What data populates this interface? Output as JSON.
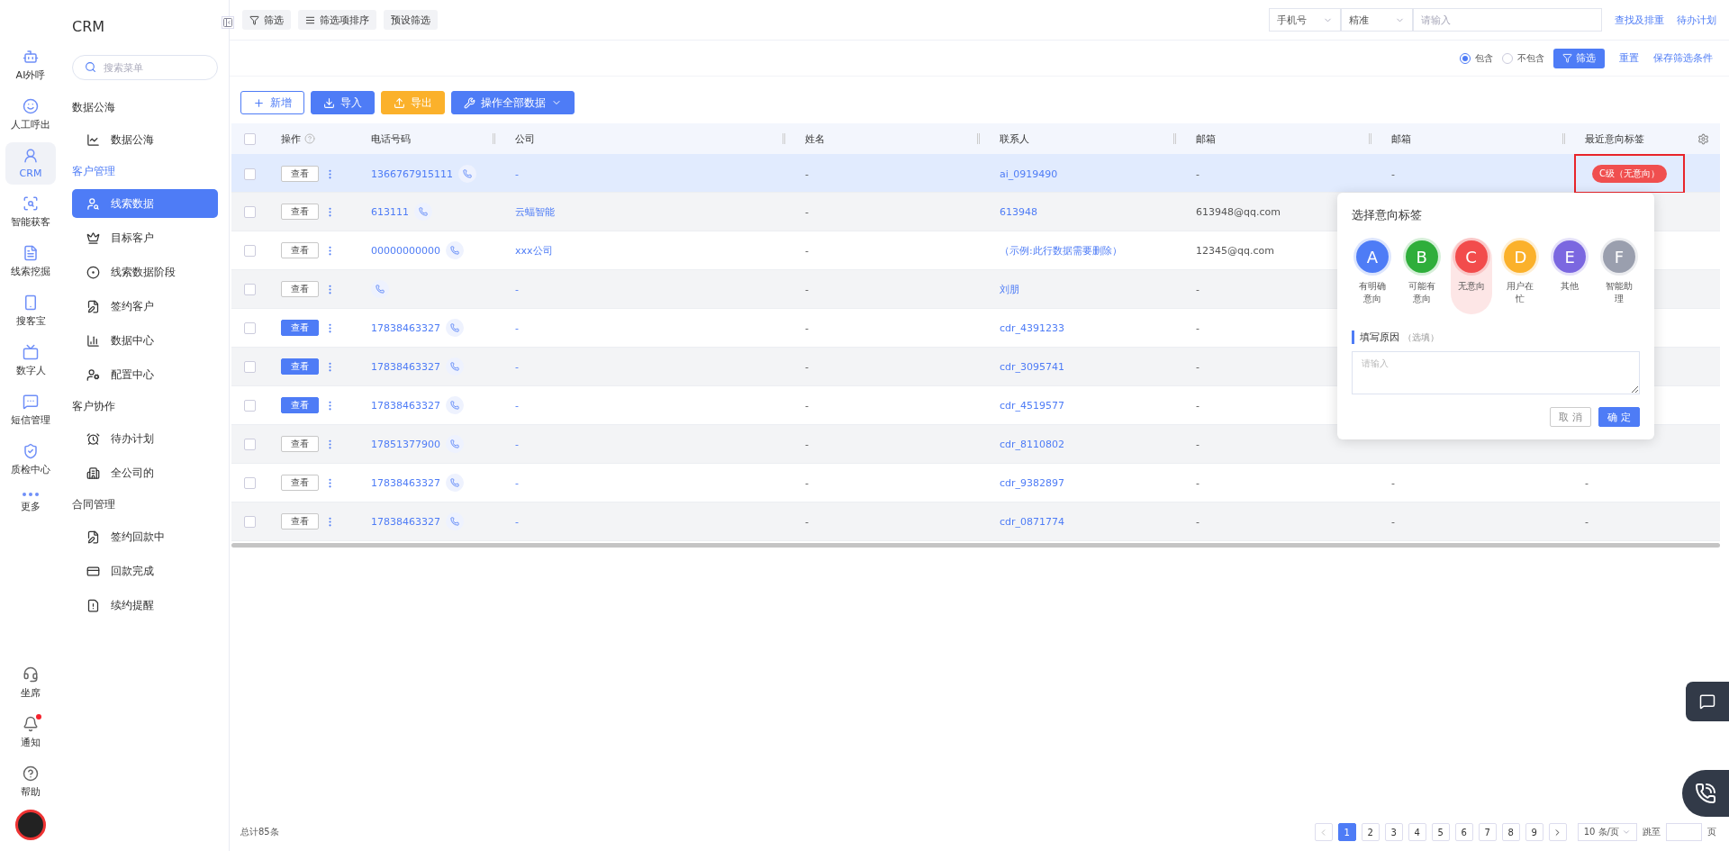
{
  "rail": {
    "items": [
      {
        "label": "AI外呼",
        "selected": false
      },
      {
        "label": "人工呼出",
        "selected": false
      },
      {
        "label": "CRM",
        "selected": true
      },
      {
        "label": "智能获客",
        "selected": false
      },
      {
        "label": "线索挖掘",
        "selected": false
      },
      {
        "label": "搜客宝",
        "selected": false
      },
      {
        "label": "数字人",
        "selected": false
      },
      {
        "label": "短信管理",
        "selected": false
      },
      {
        "label": "质检中心",
        "selected": false
      },
      {
        "label": "更多",
        "selected": false
      }
    ],
    "bottom": [
      {
        "label": "坐席",
        "has_dot": false
      },
      {
        "label": "通知",
        "has_dot": true
      },
      {
        "label": "帮助",
        "has_dot": false
      }
    ]
  },
  "sidebar": {
    "title": "CRM",
    "search": {
      "placeholder": "搜索菜单"
    },
    "groups": [
      {
        "label": "数据公海",
        "active": false,
        "items": [
          {
            "label": "数据公海",
            "selected": false
          }
        ]
      },
      {
        "label": "客户管理",
        "active": true,
        "items": [
          {
            "label": "线索数据",
            "selected": true
          },
          {
            "label": "目标客户",
            "selected": false
          },
          {
            "label": "线索数据阶段",
            "selected": false
          },
          {
            "label": "签约客户",
            "selected": false
          },
          {
            "label": "数据中心",
            "selected": false
          },
          {
            "label": "配置中心",
            "selected": false
          }
        ]
      },
      {
        "label": "客户协作",
        "active": false,
        "items": [
          {
            "label": "待办计划",
            "selected": false
          },
          {
            "label": "全公司的",
            "selected": false
          }
        ]
      },
      {
        "label": "合同管理",
        "active": false,
        "items": [
          {
            "label": "签约回款中",
            "selected": false
          },
          {
            "label": "回款完成",
            "selected": false
          },
          {
            "label": "续约提醒",
            "selected": false
          }
        ]
      }
    ]
  },
  "topbar": {
    "filter_buttons": [
      "筛选",
      "筛选项排序",
      "预设筛选"
    ],
    "field_select": "手机号",
    "match_select": "精准",
    "search": {
      "placeholder": "请输入"
    },
    "links": [
      "查找及排重",
      "待办计划"
    ]
  },
  "filter_row": {
    "options": [
      {
        "label": "包含",
        "selected": true
      },
      {
        "label": "不包含",
        "selected": false
      }
    ],
    "filter_button": "筛选",
    "links": [
      "重置",
      "保存筛选条件"
    ]
  },
  "toolbar": [
    {
      "label": "新增",
      "kind": "outline"
    },
    {
      "label": "导入",
      "kind": "primary"
    },
    {
      "label": "导出",
      "kind": "warning"
    },
    {
      "label": "操作全部数据",
      "kind": "dropdown"
    }
  ],
  "table": {
    "header_checked": false,
    "columns": [
      "操作",
      "电话号码",
      "公司",
      "姓名",
      "联系人",
      "邮箱",
      "邮箱",
      "最近意向标签"
    ],
    "rows": [
      {
        "checked": false,
        "selected": true,
        "view": "查看",
        "view_filled": false,
        "phone": "1366767915111",
        "company": "-",
        "name": "-",
        "contact": "ai_0919490",
        "email": "-",
        "email_2": "-",
        "tag": "C级（无意向）",
        "tag_highlighted": true
      },
      {
        "checked": false,
        "selected": false,
        "view": "查看",
        "view_filled": false,
        "phone": "613111",
        "company": "云蝠智能",
        "name": "-",
        "contact": "613948",
        "email": "613948@qq.com"
      },
      {
        "checked": false,
        "selected": false,
        "view": "查看",
        "view_filled": false,
        "phone": "00000000000",
        "company": "xxx公司",
        "name": "-",
        "contact": "（示例:此行数据需要删除）",
        "email": "12345@qq.com"
      },
      {
        "checked": false,
        "selected": false,
        "view": "查看",
        "view_filled": false,
        "company": "-",
        "name": "-",
        "contact": "刘朋",
        "email": "-"
      },
      {
        "checked": false,
        "selected": false,
        "view": "查看",
        "view_filled": true,
        "phone": "17838463327",
        "company": "-",
        "name": "-",
        "contact": "cdr_4391233",
        "email": "-"
      },
      {
        "checked": false,
        "selected": false,
        "view": "查看",
        "view_filled": true,
        "phone": "17838463327",
        "company": "-",
        "name": "-",
        "contact": "cdr_3095741",
        "email": "-"
      },
      {
        "checked": false,
        "selected": false,
        "view": "查看",
        "view_filled": true,
        "phone": "17838463327",
        "company": "-",
        "name": "-",
        "contact": "cdr_4519577",
        "email": "-"
      },
      {
        "checked": false,
        "selected": false,
        "view": "查看",
        "view_filled": false,
        "phone": "17851377900",
        "company": "-",
        "name": "-",
        "contact": "cdr_8110802",
        "email": "-"
      },
      {
        "checked": false,
        "selected": false,
        "view": "查看",
        "view_filled": false,
        "phone": "17838463327",
        "company": "-",
        "name": "-",
        "contact": "cdr_9382897",
        "email": "-",
        "email_2": "-",
        "tag": "-"
      },
      {
        "checked": false,
        "selected": false,
        "view": "查看",
        "view_filled": false,
        "phone": "17838463327",
        "company": "-",
        "name": "-",
        "contact": "cdr_0871774",
        "email": "-",
        "email_2": "-",
        "tag": "-"
      }
    ]
  },
  "popup": {
    "title": "选择意向标签",
    "options": [
      {
        "letter": "A",
        "label": "有明确意向",
        "color": "#4e7cf6",
        "selected": false
      },
      {
        "letter": "B",
        "label": "可能有意向",
        "color": "#2fae3b",
        "selected": false
      },
      {
        "letter": "C",
        "label": "无意向",
        "color": "#f24c4c",
        "selected": true
      },
      {
        "letter": "D",
        "label": "用户在忙",
        "color": "#fbb12b",
        "selected": false
      },
      {
        "letter": "E",
        "label": "其他",
        "color": "#7b67e0",
        "selected": false
      },
      {
        "letter": "F",
        "label": "智能助理",
        "color": "#9a9fae",
        "selected": false
      }
    ],
    "reason_label": "填写原因",
    "reason_hint": "（选填）",
    "reason": {
      "placeholder": "请输入"
    },
    "buttons": [
      "取 消",
      "确 定"
    ]
  },
  "footer": {
    "total": "总计85条",
    "pages": [
      {
        "label": "1",
        "selected": true
      },
      {
        "label": "2",
        "selected": false
      },
      {
        "label": "3",
        "selected": false
      },
      {
        "label": "4",
        "selected": false
      },
      {
        "label": "5",
        "selected": false
      },
      {
        "label": "6",
        "selected": false
      },
      {
        "label": "7",
        "selected": false
      },
      {
        "label": "8",
        "selected": false
      },
      {
        "label": "9",
        "selected": false
      }
    ],
    "page_size": "10 条/页",
    "jump_label": "跳至",
    "jump_suffix": "页"
  }
}
